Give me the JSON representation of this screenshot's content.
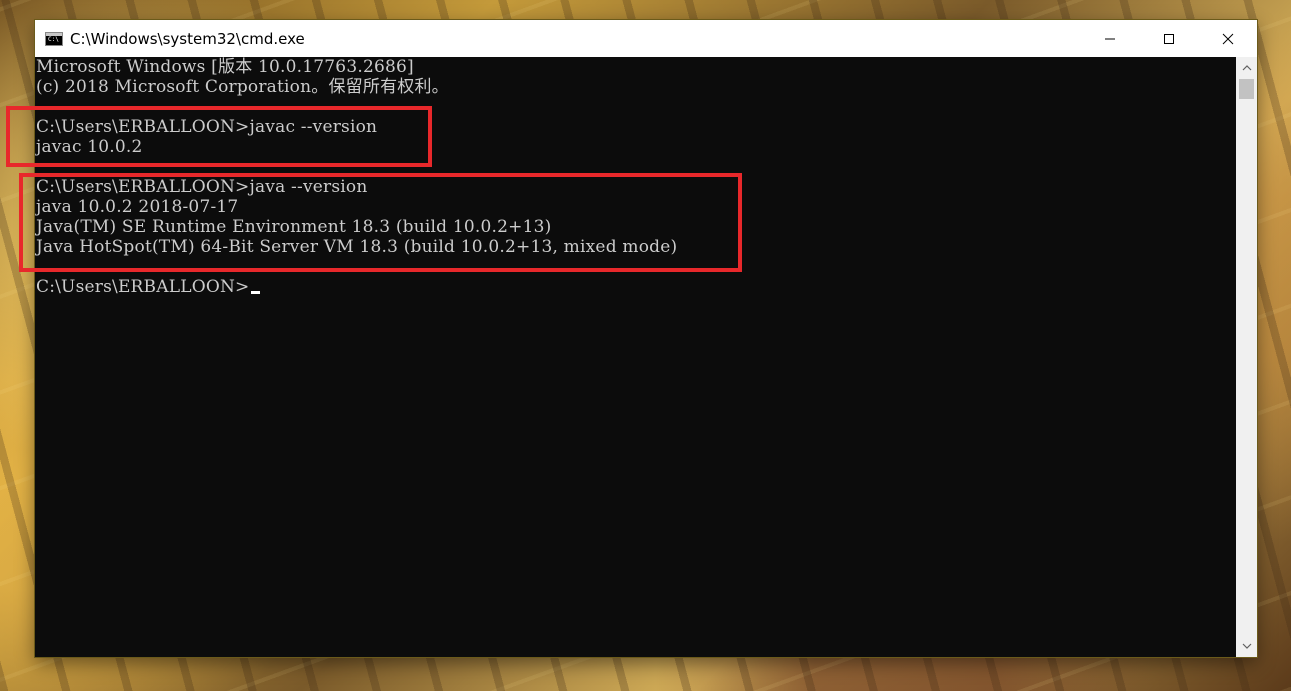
{
  "window": {
    "title": "C:\\Windows\\system32\\cmd.exe",
    "icon": "cmd-icon",
    "controls": {
      "minimize": "minimize-icon",
      "maximize": "maximize-icon",
      "close": "close-icon"
    }
  },
  "console": {
    "lines": [
      "Microsoft Windows [版本 10.0.17763.2686]",
      "(c) 2018 Microsoft Corporation。保留所有权利。",
      "",
      "C:\\Users\\ERBALLOON>javac --version",
      "javac 10.0.2",
      "",
      "C:\\Users\\ERBALLOON>java --version",
      "java 10.0.2 2018-07-17",
      "Java(TM) SE Runtime Environment 18.3 (build 10.0.2+13)",
      "Java HotSpot(TM) 64-Bit Server VM 18.3 (build 10.0.2+13, mixed mode)",
      "",
      "C:\\Users\\ERBALLOON>"
    ]
  },
  "colors": {
    "console_bg": "#0c0c0c",
    "console_text": "#cccccc",
    "highlight_border": "#e8282b"
  }
}
